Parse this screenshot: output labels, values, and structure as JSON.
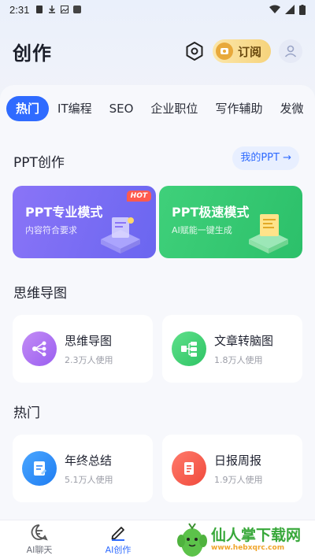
{
  "status_bar": {
    "time": "2:31"
  },
  "header": {
    "title": "创作",
    "subscribe_label": "订阅"
  },
  "tabs": [
    {
      "label": "热门",
      "active": true
    },
    {
      "label": "IT编程",
      "active": false
    },
    {
      "label": "SEO",
      "active": false
    },
    {
      "label": "企业职位",
      "active": false
    },
    {
      "label": "写作辅助",
      "active": false
    },
    {
      "label": "发微",
      "active": false
    }
  ],
  "ppt_section": {
    "title": "PPT创作",
    "my_ppt_label": "我的PPT",
    "cards": [
      {
        "title": "PPT专业模式",
        "subtitle": "内容符合要求",
        "tag": "HOT"
      },
      {
        "title": "PPT极速模式",
        "subtitle": "AI赋能一键生成"
      }
    ]
  },
  "mindmap_section": {
    "title": "思维导图",
    "cards": [
      {
        "name": "思维导图",
        "usage": "2.3万人使用"
      },
      {
        "name": "文章转脑图",
        "usage": "1.8万人使用"
      }
    ]
  },
  "hot_section": {
    "title": "热门",
    "cards": [
      {
        "name": "年终总结",
        "usage": "5.1万人使用"
      },
      {
        "name": "日报周报",
        "usage": "1.9万人使用"
      }
    ]
  },
  "bottom_nav": [
    {
      "label": "AI聊天"
    },
    {
      "label": "AI创作"
    }
  ],
  "watermark": {
    "title": "仙人掌下载网",
    "url": "www.hebxqrc.com"
  },
  "colors": {
    "accent": "#2f6bff",
    "ppt_pro": "#7b6cf6",
    "ppt_fast": "#35c96e",
    "subscribe": "#f6d37c"
  }
}
